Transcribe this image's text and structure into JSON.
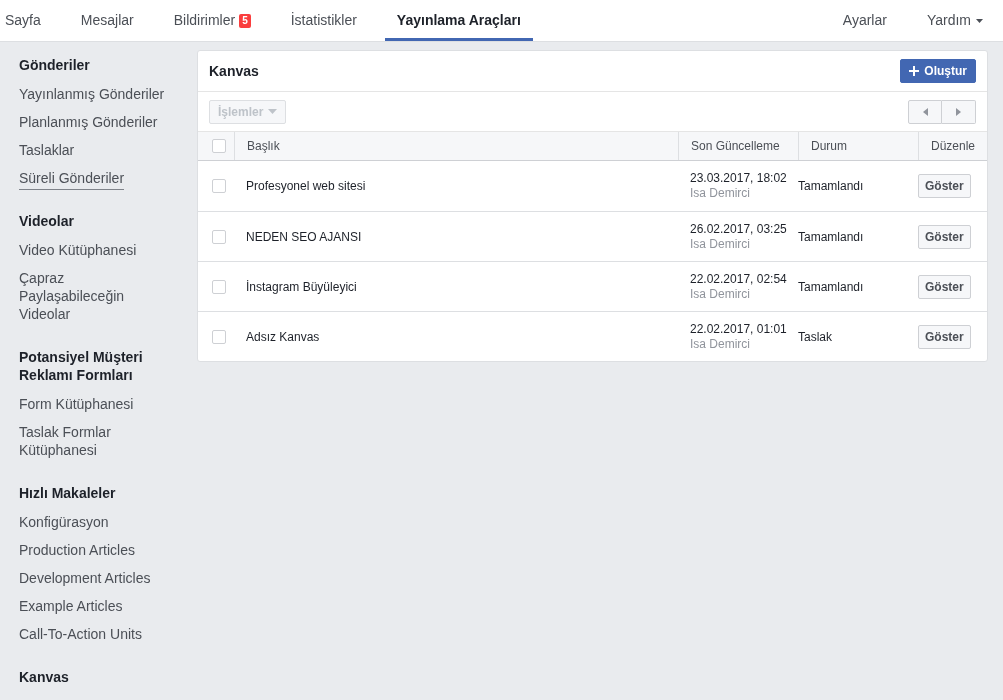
{
  "top_nav": {
    "tabs": [
      {
        "label": "Sayfa",
        "selected": false
      },
      {
        "label": "Mesajlar",
        "selected": false
      },
      {
        "label": "Bildirimler",
        "badge": "5",
        "selected": false
      },
      {
        "label": "İstatistikler",
        "selected": false
      },
      {
        "label": "Yayınlama Araçları",
        "selected": true
      }
    ],
    "right_links": [
      {
        "label": "Ayarlar",
        "dropdown": false
      },
      {
        "label": "Yardım",
        "dropdown": true
      }
    ]
  },
  "sidebar": {
    "sections": [
      {
        "heading": "Gönderiler",
        "items": [
          {
            "label": "Yayınlanmış Gönderiler",
            "hovered": false
          },
          {
            "label": "Planlanmış Gönderiler",
            "hovered": false
          },
          {
            "label": "Taslaklar",
            "hovered": false
          },
          {
            "label": "Süreli Gönderiler",
            "hovered": true
          }
        ]
      },
      {
        "heading": "Videolar",
        "items": [
          {
            "label": "Video Kütüphanesi",
            "hovered": false
          },
          {
            "label": "Çapraz Paylaşabileceğin Videolar",
            "hovered": false
          }
        ]
      },
      {
        "heading": "Potansiyel Müşteri Reklamı Formları",
        "items": [
          {
            "label": "Form Kütüphanesi",
            "hovered": false
          },
          {
            "label": "Taslak Formlar Kütüphanesi",
            "hovered": false
          }
        ]
      },
      {
        "heading": "Hızlı Makaleler",
        "items": [
          {
            "label": "Konfigürasyon",
            "hovered": false
          },
          {
            "label": "Production Articles",
            "hovered": false
          },
          {
            "label": "Development Articles",
            "hovered": false
          },
          {
            "label": "Example Articles",
            "hovered": false
          },
          {
            "label": "Call-To-Action Units",
            "hovered": false
          }
        ]
      },
      {
        "heading": "Kanvas"
      }
    ]
  },
  "panel": {
    "title": "Kanvas",
    "create_button": "Oluştur",
    "actions_dropdown": {
      "label": "İşlemler",
      "disabled": true
    },
    "table": {
      "select_all": {
        "checked": false
      },
      "columns": [
        "Başlık",
        "Son Güncelleme",
        "Durum",
        "Düzenle"
      ],
      "rows": [
        {
          "checked": false,
          "title": "Profesyonel web sitesi",
          "updated": "23.03.2017, 18:02",
          "author": "Isa Demirci",
          "status": "Tamamlandı",
          "action": "Göster"
        },
        {
          "checked": false,
          "title": "NEDEN SEO AJANSI",
          "updated": "26.02.2017, 03:25",
          "author": "Isa Demirci",
          "status": "Tamamlandı",
          "action": "Göster"
        },
        {
          "checked": false,
          "title": "İnstagram Büyüleyici",
          "updated": "22.02.2017, 02:54",
          "author": "Isa Demirci",
          "status": "Tamamlandı",
          "action": "Göster"
        },
        {
          "checked": false,
          "title": "Adsız Kanvas",
          "updated": "22.02.2017, 01:01",
          "author": "Isa Demirci",
          "status": "Taslak",
          "action": "Göster"
        }
      ]
    }
  }
}
